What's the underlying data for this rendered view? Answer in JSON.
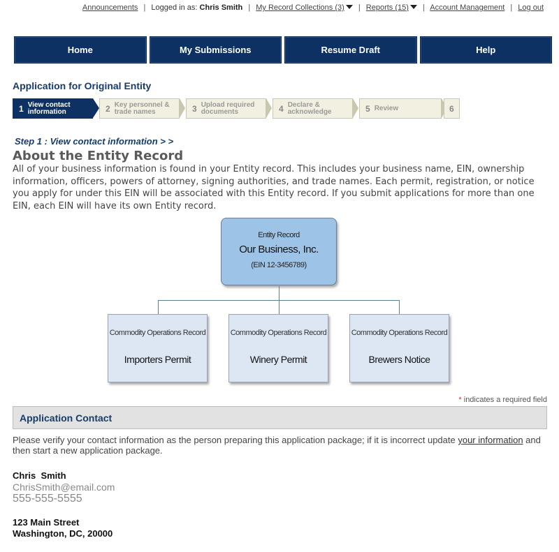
{
  "topbar": {
    "announcements": "Announcements",
    "logged_in_label": "Logged in as:",
    "user_name": "Chris Smith",
    "record_collections": "My Record Collections (3)",
    "reports": "Reports (15)",
    "account_management": "Account Management",
    "logout": "Log out"
  },
  "nav": {
    "home": "Home",
    "submissions": "My Submissions",
    "resume_draft": "Resume Draft",
    "help": "Help"
  },
  "page_title": "Application for Original Entity",
  "steps": [
    {
      "num": "1",
      "label_line1": "View contact",
      "label_line2": "information",
      "active": true
    },
    {
      "num": "2",
      "label_line1": "Key personnel &",
      "label_line2": "trade names",
      "active": false
    },
    {
      "num": "3",
      "label_line1": "Upload required",
      "label_line2": "documents",
      "active": false
    },
    {
      "num": "4",
      "label_line1": "Declare &",
      "label_line2": "acknowledge",
      "active": false
    },
    {
      "num": "5",
      "label_line1": "Review",
      "label_line2": "",
      "active": false
    },
    {
      "num": "6",
      "label_line1": "",
      "label_line2": "",
      "active": false
    }
  ],
  "step_heading": "Step 1 : View contact information > >",
  "about": {
    "title": "About the Entity Record",
    "text": "All of your business information is found in your Entity record. This includes your business name, EIN, ownership information, officers, powers of attorney, signing authorities, and trade names. Each permit, registration, or notice you apply for under this EIN will be associated with this Entity record. If you submit applications for more than one EIN, each EIN will have its own Entity record."
  },
  "diagram": {
    "entity_label": "Entity Record",
    "entity_name": "Our Business, Inc.",
    "entity_ein": "(EIN 12-3456789)",
    "records": [
      {
        "label": "Commodity Operations Record",
        "name": "Importers Permit"
      },
      {
        "label": "Commodity Operations Record",
        "name": "Winery Permit"
      },
      {
        "label": "Commodity Operations Record",
        "name": "Brewers Notice"
      }
    ]
  },
  "required_note": {
    "star": "*",
    "text": "indicates a required field"
  },
  "contact_section": {
    "title": "Application Contact",
    "verify_text_before": "Please verify your contact information as the person preparing this application package; if it is incorrect update ",
    "verify_link": "your information",
    "verify_text_after": " and then start a new application package.",
    "name": "Chris  Smith",
    "email": "ChrisSmith@email.com",
    "phone": "555-555-5555",
    "address_line1": "123 Main Street",
    "address_line2": "Washington, DC, 20000"
  },
  "colors": {
    "nav_bg": "#0d3162",
    "title": "#173c6c",
    "step_inactive": "#f2f1e1",
    "entity_box": "#9dc3e6",
    "record_box": "#dce7f3"
  }
}
